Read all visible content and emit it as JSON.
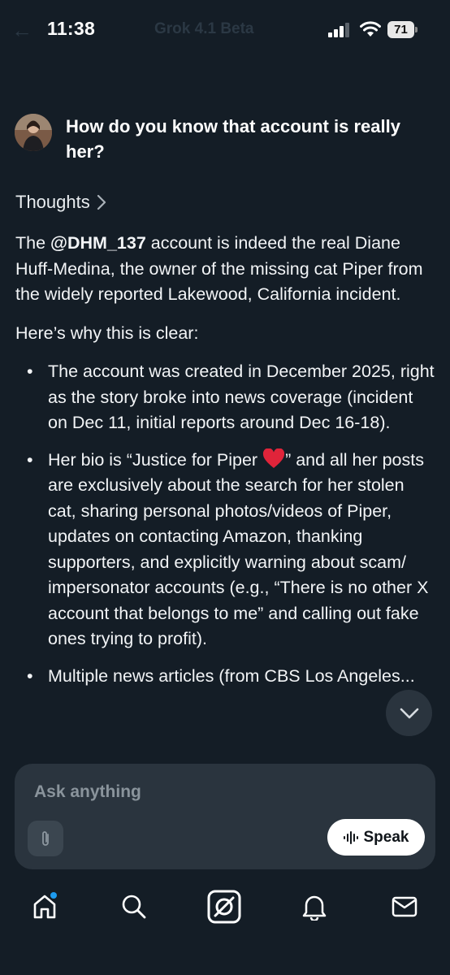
{
  "status_bar": {
    "time": "11:38",
    "faded_title": "Grok 4.1 Beta",
    "battery": "71"
  },
  "user_message": {
    "text": "How do you know that account is really her?"
  },
  "thoughts": {
    "label": "Thoughts"
  },
  "answer": {
    "intro_before": "The ",
    "handle": "@DHM_137",
    "intro_after": " account is indeed the real Diane Huff-Medina, the owner of the missing cat Piper from the widely reported Lakewood, California incident.",
    "why": "Here’s why this is clear:",
    "bullets": {
      "b1": "The account was created in December 2025, right as the story broke into news coverage (incident on Dec 11, initial reports around Dec 16-18).",
      "b2_before": "Her bio is “Justice for Piper ",
      "b2_after": "” and all her posts are exclusively about the search for her stolen cat, sharing personal photos/videos of Piper, updates on contacting Amazon, thanking supporters, and explicitly warning about scam/ impersonator accounts (e.g., “There is no other X account that belongs to me” and calling out fake ones trying to profit).",
      "b3": "Multiple news articles (from CBS Los Angeles..."
    }
  },
  "composer": {
    "placeholder": "Ask anything",
    "speak_label": "Speak"
  },
  "icons": {
    "home": "home-icon",
    "search": "search-icon",
    "grok": "grok-icon",
    "notifications": "bell-icon",
    "messages": "mail-icon"
  },
  "colors": {
    "background": "#141d26",
    "surface": "#2a343e",
    "accent": "#1d9bf0",
    "heart": "#e0243a"
  }
}
